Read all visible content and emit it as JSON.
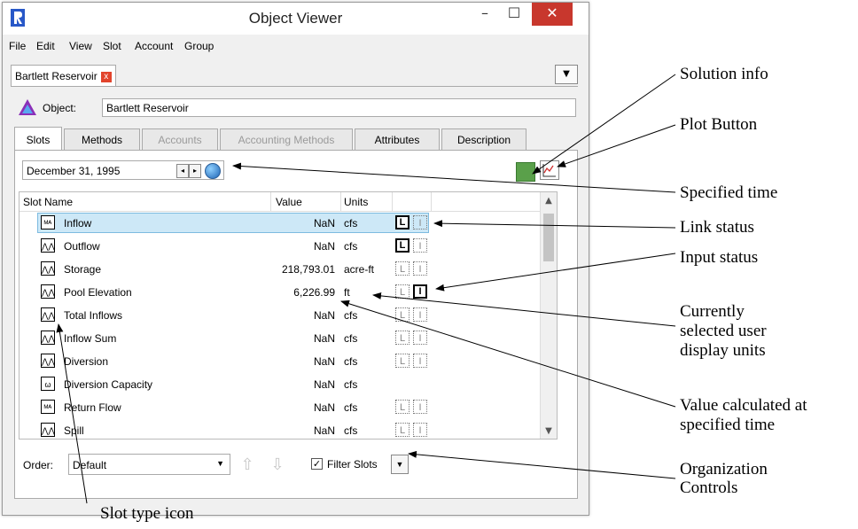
{
  "window": {
    "title": "Object Viewer",
    "minimize_label": "–",
    "maximize_label": "☐",
    "close_label": "✕"
  },
  "menu": {
    "items": [
      "File",
      "Edit",
      "View",
      "Slot",
      "Account",
      "Group"
    ]
  },
  "doc_tab": {
    "label": "Bartlett Reservoir",
    "close_label": "x",
    "dropdown_label": "▼"
  },
  "object": {
    "label": "Object:",
    "value": "Bartlett Reservoir"
  },
  "tabs": [
    {
      "label": "Slots",
      "state": "active"
    },
    {
      "label": "Methods",
      "state": "normal"
    },
    {
      "label": "Accounts",
      "state": "disabled"
    },
    {
      "label": "Accounting Methods",
      "state": "disabled"
    },
    {
      "label": "Attributes",
      "state": "normal"
    },
    {
      "label": "Description",
      "state": "normal"
    }
  ],
  "time": {
    "value": "December 31, 1995",
    "prev_label": "◂",
    "next_label": "▸"
  },
  "solution_info_color": "#5aa04a",
  "table": {
    "headers": {
      "name": "Slot Name",
      "value": "Value",
      "units": "Units"
    },
    "rows": [
      {
        "icon": "timeseries-multi-icon",
        "glyph": "ᴹᴬ",
        "name": "Inflow",
        "value": "NaN",
        "units": "cfs",
        "link": "on",
        "input": "off",
        "selected": true
      },
      {
        "icon": "timeseries-icon",
        "glyph": "⋀⋀",
        "name": "Outflow",
        "value": "NaN",
        "units": "cfs",
        "link": "on",
        "input": "off",
        "selected": false
      },
      {
        "icon": "timeseries-icon",
        "glyph": "⋀⋀",
        "name": "Storage",
        "value": "218,793.01",
        "units": "acre-ft",
        "link": "off",
        "input": "off",
        "selected": false
      },
      {
        "icon": "timeseries-icon",
        "glyph": "⋀⋀",
        "name": "Pool Elevation",
        "value": "6,226.99",
        "units": "ft",
        "link": "off",
        "input": "on",
        "selected": false
      },
      {
        "icon": "timeseries-icon",
        "glyph": "⋀⋀",
        "name": "Total Inflows",
        "value": "NaN",
        "units": "cfs",
        "link": "off",
        "input": "off",
        "selected": false
      },
      {
        "icon": "agg-series-icon",
        "glyph": "⋀⋀",
        "name": "Inflow Sum",
        "value": "NaN",
        "units": "cfs",
        "link": "off",
        "input": "off",
        "selected": false
      },
      {
        "icon": "timeseries-icon",
        "glyph": "⋀⋀",
        "name": "Diversion",
        "value": "NaN",
        "units": "cfs",
        "link": "off",
        "input": "off",
        "selected": false
      },
      {
        "icon": "expression-icon",
        "glyph": "ω",
        "name": "Diversion Capacity",
        "value": "NaN",
        "units": "cfs",
        "link": "none",
        "input": "none",
        "selected": false
      },
      {
        "icon": "timeseries-multi-icon",
        "glyph": "ᴹᴬ",
        "name": "Return Flow",
        "value": "NaN",
        "units": "cfs",
        "link": "off",
        "input": "off",
        "selected": false
      },
      {
        "icon": "timeseries-icon",
        "glyph": "⋀⋀",
        "name": "Spill",
        "value": "NaN",
        "units": "cfs",
        "link": "off",
        "input": "off",
        "selected": false
      }
    ],
    "link_glyph": "L",
    "input_glyph": "I"
  },
  "bottom": {
    "order_label": "Order:",
    "order_value": "Default",
    "filter_label": "Filter Slots",
    "filter_checked": true
  },
  "callouts": {
    "solution_info": "Solution info",
    "plot_button": "Plot Button",
    "specified_time": "Specified time",
    "link_status": "Link status",
    "input_status": "Input status",
    "display_units_1": "Currently",
    "display_units_2": "selected user",
    "display_units_3": "display units",
    "value_calc_1": "Value calculated at",
    "value_calc_2": "specified time",
    "org_controls_1": "Organization",
    "org_controls_2": "Controls",
    "slot_type_icon": "Slot type icon"
  }
}
